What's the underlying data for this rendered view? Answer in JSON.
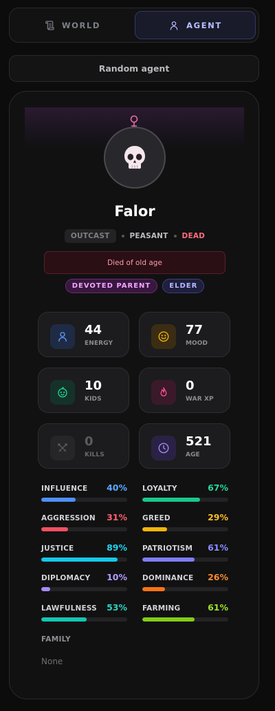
{
  "tabs": [
    {
      "label": "WORLD",
      "icon": "scroll-icon",
      "active": false
    },
    {
      "label": "AGENT",
      "icon": "person-icon",
      "active": true
    }
  ],
  "random_button": "Random agent",
  "agent": {
    "name": "Falor",
    "gender_icon": "female-symbol-icon",
    "avatar_icon": "skull-icon",
    "tag": "OUTCAST",
    "caste": "PEASANT",
    "status": "DEAD",
    "death_reason": "Died of old age",
    "traits": [
      "DEVOTED PARENT",
      "ELDER"
    ]
  },
  "stats": [
    {
      "value": "44",
      "label": "ENERGY",
      "icon": "person-icon",
      "color": "#5b9bff"
    },
    {
      "value": "77",
      "label": "MOOD",
      "icon": "smile-icon",
      "color": "#f5b70a"
    },
    {
      "value": "10",
      "label": "KIDS",
      "icon": "baby-icon",
      "color": "#22d38a"
    },
    {
      "value": "0",
      "label": "WAR XP",
      "icon": "flame-icon",
      "color": "#ff4f8b"
    },
    {
      "value": "0",
      "label": "KILLS",
      "icon": "crossed-swords-icon",
      "color": "#5c5c60"
    },
    {
      "value": "521",
      "label": "AGE",
      "icon": "clock-icon",
      "color": "#a78bfa"
    }
  ],
  "bars": [
    {
      "name": "INFLUENCE",
      "pct": "40%",
      "value": 0.4,
      "color": "#4f8ff7",
      "text_color": "#5aa8ff"
    },
    {
      "name": "LOYALTY",
      "pct": "67%",
      "value": 0.67,
      "color": "#17c98a",
      "text_color": "#26d89b"
    },
    {
      "name": "AGGRESSION",
      "pct": "31%",
      "value": 0.31,
      "color": "#f2505f",
      "text_color": "#ff5f6e"
    },
    {
      "name": "GREED",
      "pct": "29%",
      "value": 0.29,
      "color": "#f6b50a",
      "text_color": "#fbbf24"
    },
    {
      "name": "JUSTICE",
      "pct": "89%",
      "value": 0.89,
      "color": "#16c8e8",
      "text_color": "#22d3ee"
    },
    {
      "name": "PATRIOTISM",
      "pct": "61%",
      "value": 0.61,
      "color": "#7e7ef6",
      "text_color": "#8b8cff"
    },
    {
      "name": "DIPLOMACY",
      "pct": "10%",
      "value": 0.1,
      "color": "#a78bfa",
      "text_color": "#b39bff"
    },
    {
      "name": "DOMINANCE",
      "pct": "26%",
      "value": 0.26,
      "color": "#f97316",
      "text_color": "#fb8a2e"
    },
    {
      "name": "LAWFULNESS",
      "pct": "53%",
      "value": 0.53,
      "color": "#14c7b2",
      "text_color": "#2dd4bf"
    },
    {
      "name": "FARMING",
      "pct": "61%",
      "value": 0.61,
      "color": "#84cc16",
      "text_color": "#9be22a"
    }
  ],
  "family": {
    "title": "FAMILY",
    "value": "None"
  }
}
